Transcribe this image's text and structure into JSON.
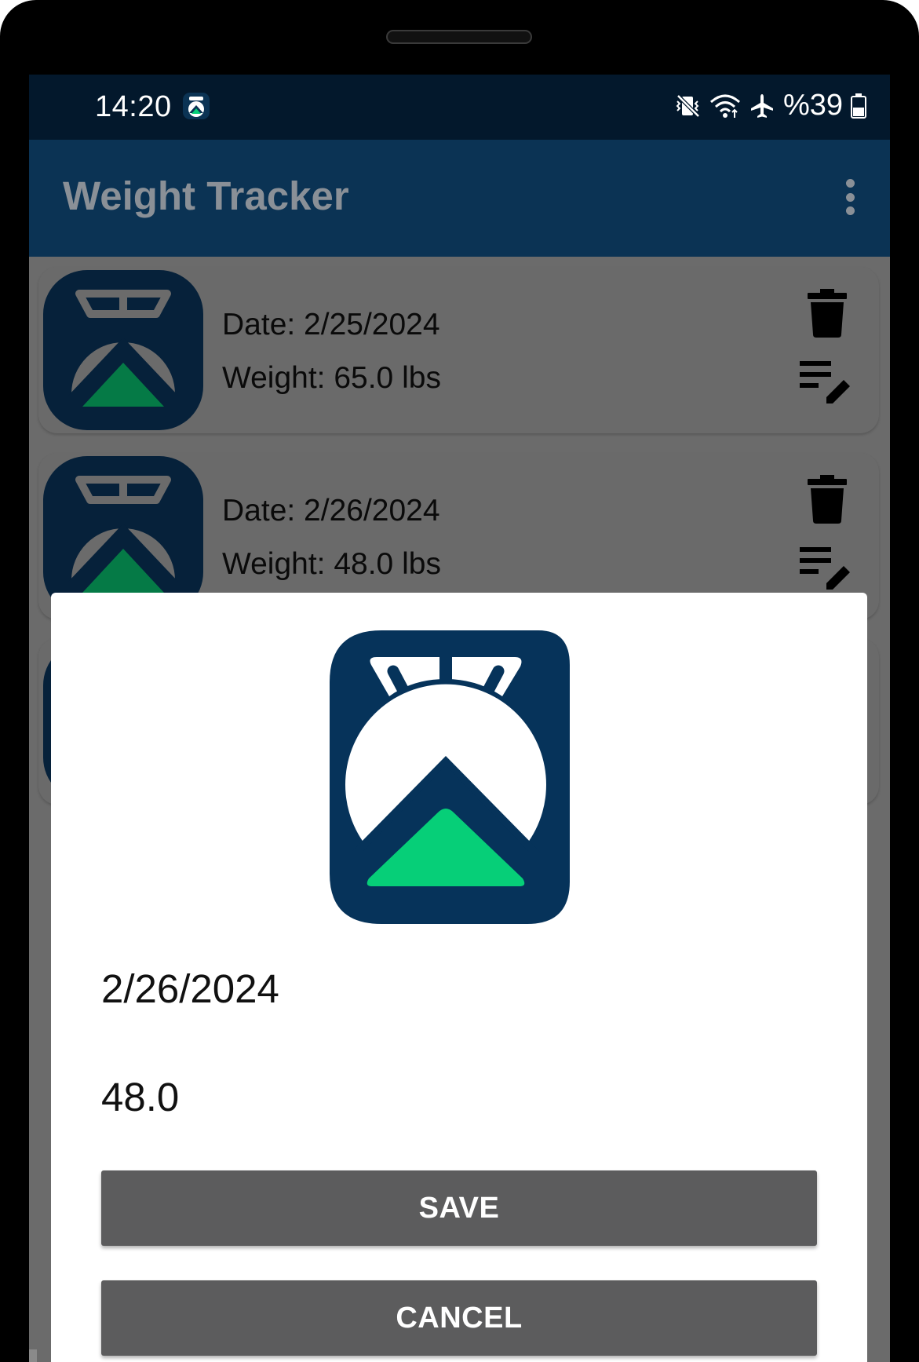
{
  "status_bar": {
    "time": "14:20",
    "battery_text": "%39",
    "icons": [
      "app-notification-icon",
      "vibrate-mute-icon",
      "wifi-icon",
      "airplane-mode-icon",
      "battery-icon"
    ]
  },
  "app_bar": {
    "title": "Weight Tracker",
    "menu_icon": "overflow-menu-icon"
  },
  "entries": [
    {
      "date": "Date: 2/25/2024",
      "weight": "Weight: 65.0 lbs"
    },
    {
      "date": "Date: 2/26/2024",
      "weight": "Weight: 48.0 lbs"
    }
  ],
  "dialog": {
    "date_value": "2/26/2024",
    "weight_value": "48.0",
    "save_label": "SAVE",
    "cancel_label": "CANCEL"
  },
  "colors": {
    "status_bar": "#03182c",
    "app_bar": "#0b3354",
    "logo_navy": "#06335a",
    "logo_green": "#06cf78",
    "button": "#5c5c5d",
    "scrim": "#6b6b6b"
  }
}
